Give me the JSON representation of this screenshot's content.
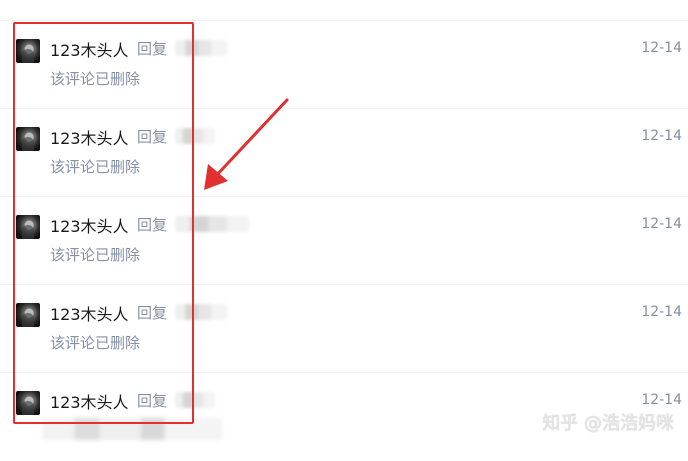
{
  "rows": [
    {
      "user": "123木头人",
      "reply_label": "回复",
      "comment": "该评论已删除",
      "date": "12-14"
    },
    {
      "user": "123木头人",
      "reply_label": "回复",
      "comment": "该评论已删除",
      "date": "12-14"
    },
    {
      "user": "123木头人",
      "reply_label": "回复",
      "comment": "该评论已删除",
      "date": "12-14"
    },
    {
      "user": "123木头人",
      "reply_label": "回复",
      "comment": "该评论已删除",
      "date": "12-14"
    },
    {
      "user": "123木头人",
      "reply_label": "回复",
      "comment": "",
      "date": "12-14"
    }
  ],
  "watermark": "知乎 @浩浩妈咪",
  "colors": {
    "highlight": "#e03030",
    "meta_text": "#8590a6",
    "primary_text": "#1a1a1a"
  }
}
